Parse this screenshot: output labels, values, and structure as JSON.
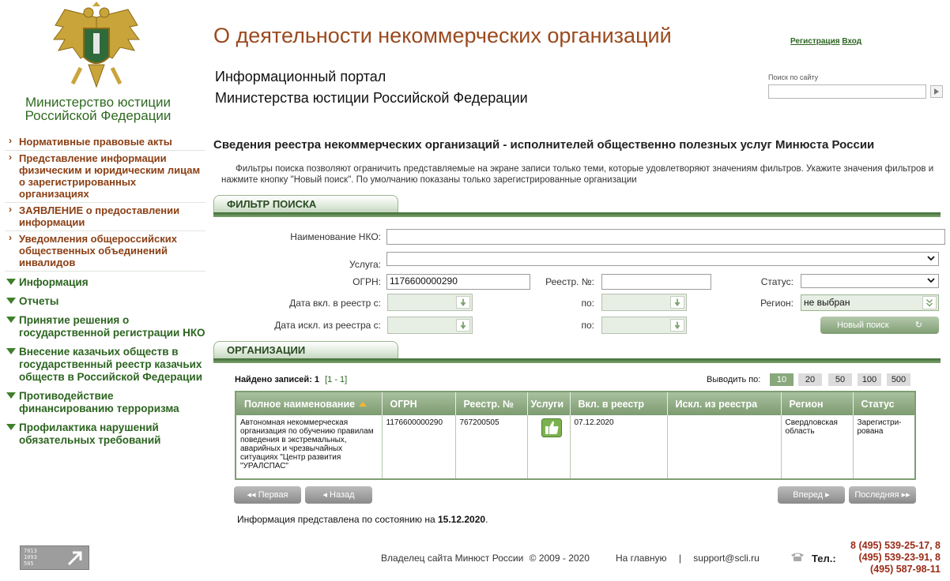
{
  "sidebar": {
    "ministry_line1": "Министерство юстиции",
    "ministry_line2": "Российской Федерации",
    "sub_items": [
      "Нормативные правовые акты",
      "Представление информации физическим и юридическим лицам о зарегистрированных организациях",
      "ЗАЯВЛЕНИЕ о предоставлении информации",
      "Уведомления общероссийских общественных объединений инвалидов"
    ],
    "nav_items": [
      "Информация",
      "Отчеты",
      "Принятие решения о государственной регистрации НКО",
      "Внесение казачьих обществ в государственный реестр казачьих обществ в Российской Федерации",
      "Противодействие финансированию терроризма",
      "Профилактика нарушений обязательных требований"
    ]
  },
  "header": {
    "title": "О деятельности некоммерческих организаций",
    "portal_line1": "Информационный портал",
    "portal_line2": "Министерства юстиции Российской Федерации",
    "register_link": "Регистрация",
    "login_link": "Вход",
    "search_label": "Поиск по сайту",
    "search_value": ""
  },
  "content": {
    "heading": "Сведения реестра некоммерческих организаций - исполнителей общественно полезных услуг Минюста России",
    "intro": "Фильтры поиска позволяют ограничить представляемые на экране записи только теми, которые удовлетворяют значениям фильтров. Укажите значения фильтров и нажмите кнопку \"Новый поиск\". По умолчанию показаны только зарегистрированные организации"
  },
  "filter": {
    "section_title": "ФИЛЬТР ПОИСКА",
    "name_label": "Наименование НКО:",
    "name_value": "",
    "service_label": "Услуга:",
    "service_value": "",
    "ogrn_label": "ОГРН:",
    "ogrn_value": "1176600000290",
    "reg_no_label": "Реестр. №:",
    "reg_no_value": "",
    "status_label": "Статус:",
    "status_value": "",
    "date_in_label": "Дата вкл. в реестр с:",
    "date_out_label": "Дата искл. из реестра с:",
    "to_label": "по:",
    "region_label": "Регион:",
    "region_value": "не выбран",
    "new_search_button": "Новый поиск"
  },
  "orgs": {
    "section_title": "ОРГАНИЗАЦИИ",
    "found_label": "Найдено записей:",
    "found_count": "1",
    "range": "[1 - 1]",
    "per_page_label": "Выводить по:",
    "per_page_options": [
      "10",
      "20",
      "50",
      "100",
      "500"
    ],
    "per_page_selected": "10",
    "columns": [
      "Полное наименование",
      "ОГРН",
      "Реестр. №",
      "Услуги",
      "Вкл. в реестр",
      "Искл. из реестра",
      "Регион",
      "Статус"
    ],
    "rows": [
      {
        "name": "Автономная некоммерческая организация по обучению правилам поведения в экстремальных, аварийных и чрезвычайных ситуациях \"Центр развития \"УРАЛСПАС\"",
        "ogrn": "1176600000290",
        "reg_no": "767200505",
        "services_icon": "thumbs-up-icon",
        "included": "07.12.2020",
        "excluded": "",
        "region": "Свердловская область",
        "status": "Зарегистри-рована"
      }
    ],
    "pager": {
      "first": "Первая",
      "prev": "Назад",
      "next": "Вперед",
      "last": "Последняя"
    },
    "info_prefix": "Информация представлена по состоянию на",
    "info_date": "15.12.2020",
    "info_suffix": "."
  },
  "footer": {
    "counter_digits": [
      "7013",
      "1093",
      "505"
    ],
    "owner": "Владелец сайта Минюст России",
    "copyright": "© 2009 - 2020",
    "home_link": "На главную",
    "separator": "|",
    "support_email": "support@scli.ru",
    "tel_label": "Тел.:",
    "phones": [
      "8 (495) 539-25-17, 8",
      "(495) 539-23-91, 8",
      "(495) 587-98-11"
    ]
  },
  "colors": {
    "brand_brown": "#9a4a1e",
    "brand_green": "#2c6420",
    "phone_red": "#9a2b16"
  }
}
